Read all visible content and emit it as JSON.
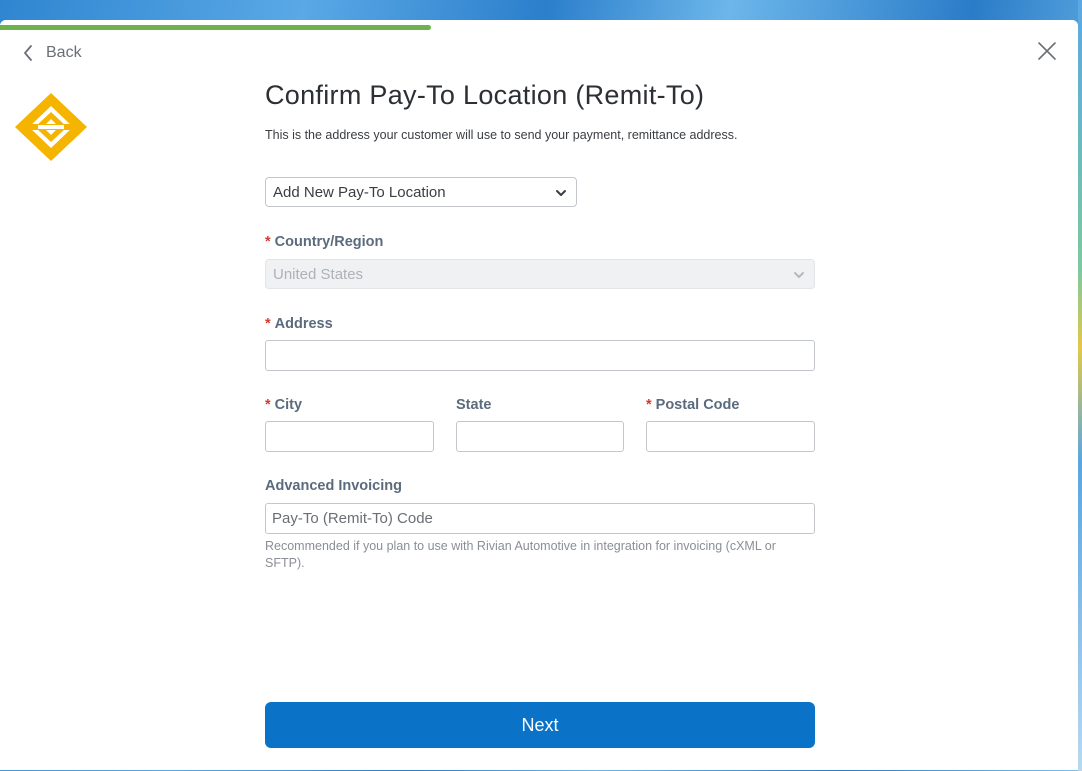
{
  "progress": {
    "fraction": 0.4
  },
  "nav": {
    "back_label": "Back"
  },
  "header": {
    "title": "Confirm Pay-To Location (Remit-To)",
    "subtitle": "This is the address your customer will use to send your payment, remittance address."
  },
  "location_select": {
    "value": "Add New Pay-To Location"
  },
  "form": {
    "required_marker": "*",
    "country": {
      "label": "Country/Region",
      "value": "United States"
    },
    "address": {
      "label": "Address",
      "value": ""
    },
    "city": {
      "label": "City",
      "value": ""
    },
    "state": {
      "label": "State",
      "value": ""
    },
    "postal": {
      "label": "Postal Code",
      "value": ""
    },
    "advanced": {
      "label": "Advanced Invoicing",
      "placeholder": "Pay-To (Remit-To) Code",
      "help": "Recommended if you plan to use with Rivian Automotive in integration for invoicing (cXML or SFTP)."
    }
  },
  "actions": {
    "next_label": "Next"
  },
  "colors": {
    "accent": "#0b73c7",
    "progress": "#6db24a",
    "required": "#d23a2f",
    "logo": "#f5b400"
  },
  "icons": [
    "chevron-left-icon",
    "close-icon",
    "brand-logo",
    "chevron-down-icon"
  ]
}
